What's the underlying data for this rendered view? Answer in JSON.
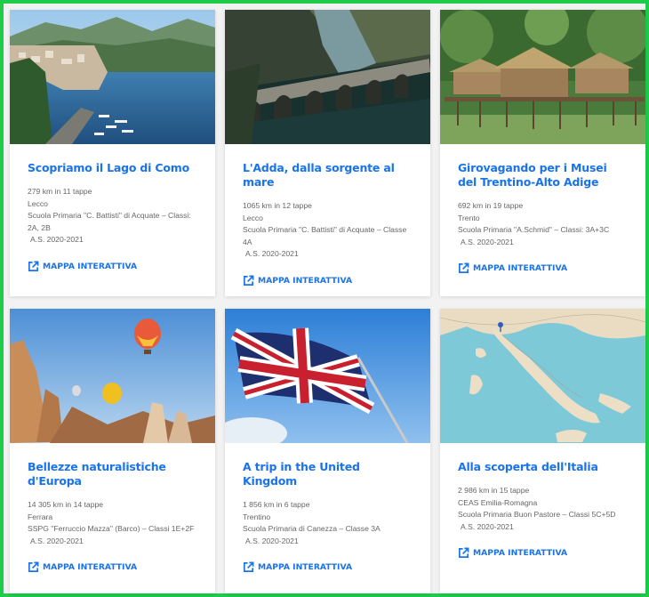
{
  "accent_color": "#1a73e8",
  "frame_color": "#1ecc4a",
  "cards": [
    {
      "image": "lake-como-photo",
      "title": "Scopriamo il Lago di Como",
      "distance": "279 km in 11 tappe",
      "place": "Lecco",
      "school": "Scuola Primaria \"C. Battisti\" di Acquate – Classi: 2A, 2B",
      "year": "A.S. 2020-2021",
      "link": "MAPPA INTERATTIVA",
      "link_icon": "external-link-icon"
    },
    {
      "image": "adda-river-dam-photo",
      "title": "L'Adda, dalla sorgente al mare",
      "distance": "1065 km in 12 tappe",
      "place": "Lecco",
      "school": "Scuola Primaria \"C. Battisti\" di Acquate – Classe 4A",
      "year": "A.S. 2020-2021",
      "link": "MAPPA INTERATTIVA",
      "link_icon": "external-link-icon"
    },
    {
      "image": "stilt-houses-photo",
      "title": "Girovagando per i Musei del Trentino-Alto Adige",
      "distance": "692 km in 19 tappe",
      "place": "Trento",
      "school": "Scuola Primaria \"A.Schmid\" – Classi: 3A+3C",
      "year": "A.S. 2020-2021",
      "link": "MAPPA INTERATTIVA",
      "link_icon": "external-link-icon"
    },
    {
      "image": "cappadocia-balloons-photo",
      "title": "Bellezze naturalistiche d'Europa",
      "distance": "14 305 km in 14 tappe",
      "place": "Ferrara",
      "school": "SSPG \"Ferruccio Mazza\" (Barco) – Classi 1E+2F",
      "year": "A.S. 2020-2021",
      "link": "MAPPA INTERATTIVA",
      "link_icon": "external-link-icon"
    },
    {
      "image": "union-jack-flag-photo",
      "title": "A trip in the United Kingdom",
      "distance": "1 856 km in 6 tappe",
      "place": "Trentino",
      "school": "Scuola Primaria di Canezza – Classe 3A",
      "year": "A.S. 2020-2021",
      "link": "MAPPA INTERATTIVA",
      "link_icon": "external-link-icon"
    },
    {
      "image": "italy-map-image",
      "title": "Alla scoperta dell'Italia",
      "distance": "2 986 km in 15 tappe",
      "place": "CEAS Emilia-Romagna",
      "school": "Scuola Primaria Buon Pastore – Classi 5C+5D",
      "year": "A.S. 2020-2021",
      "link": "MAPPA INTERATTIVA",
      "link_icon": "external-link-icon"
    }
  ]
}
